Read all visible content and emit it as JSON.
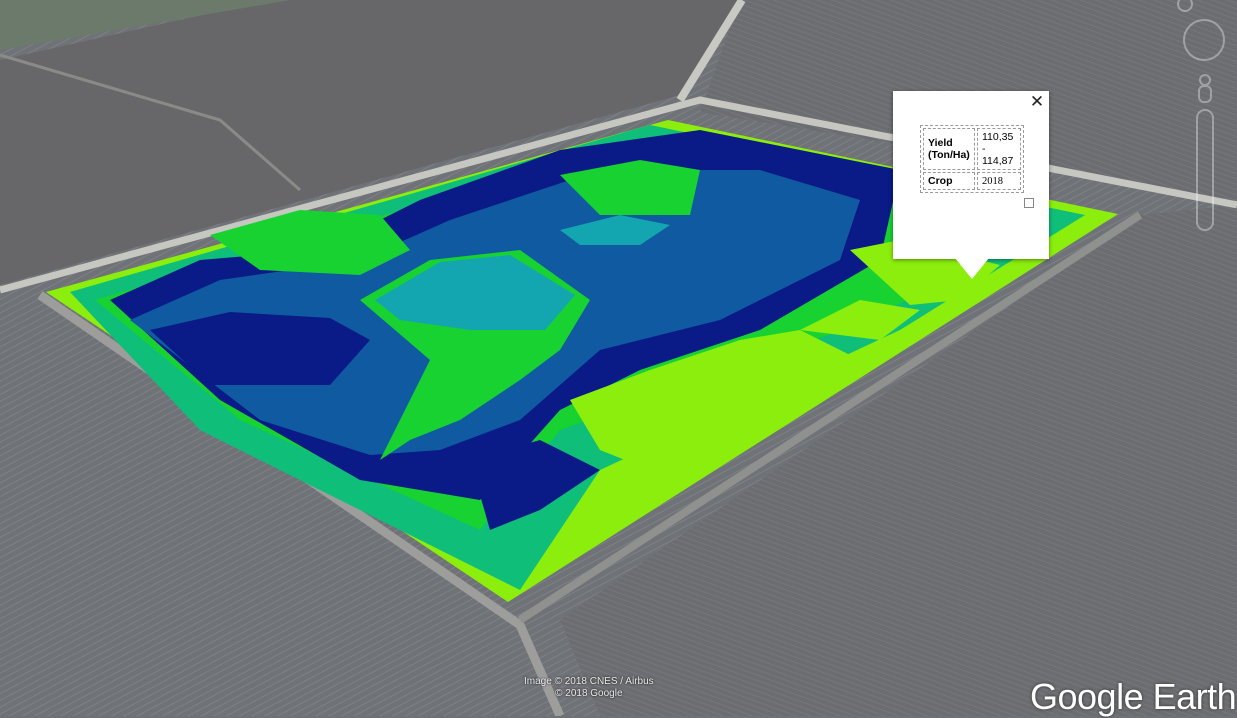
{
  "popup": {
    "rows": [
      {
        "key": "Yield (Ton/Ha)",
        "value": "110,35 - 114,87"
      },
      {
        "key": "Crop",
        "value": "2018"
      }
    ],
    "close_glyph": "✕"
  },
  "attribution": {
    "line1": "Image © 2018 CNES / Airbus",
    "line2": "© 2018 Google"
  },
  "logo": "Google Earth",
  "legend_colors": {
    "darkest": "#0a1a86",
    "dark": "#0f5aa0",
    "teal": "#14a6b0",
    "green": "#18d232",
    "seagreen": "#0fbe78",
    "lime": "#8cee0c"
  },
  "icons": [
    "compass-icon",
    "tilt-control-icon",
    "pegman-icon",
    "zoom-slider-icon",
    "close-icon"
  ]
}
